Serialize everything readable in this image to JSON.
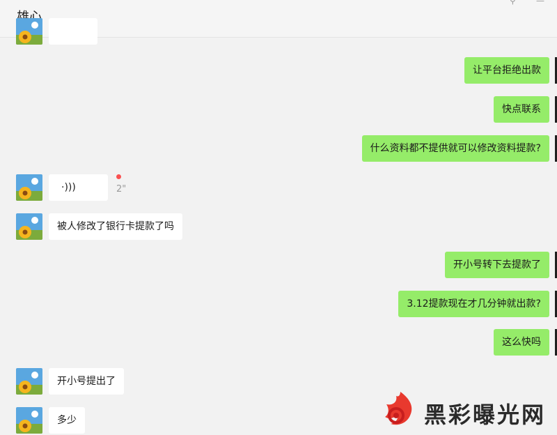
{
  "header": {
    "title": "雄心",
    "pin_icon": "pin-icon",
    "minimize_icon": "minimize-icon"
  },
  "colors": {
    "sent_bubble": "#95ec69",
    "received_bubble": "#ffffff",
    "unread_dot": "#fa5151"
  },
  "messages": [
    {
      "side": "left",
      "text": "",
      "partial": true
    },
    {
      "side": "right",
      "text": "让平台拒绝出款"
    },
    {
      "side": "right",
      "text": "快点联系"
    },
    {
      "side": "right",
      "text": "什么资料都不提供就可以修改资料提款?"
    },
    {
      "side": "left",
      "type": "voice",
      "voice_icon": "voice-wave-icon",
      "duration": "2\"",
      "unread": true
    },
    {
      "side": "left",
      "text": "被人修改了银行卡提款了吗"
    },
    {
      "side": "right",
      "text": "开小号转下去提款了"
    },
    {
      "side": "right",
      "text": "3.12提款现在才几分钟就出款?"
    },
    {
      "side": "right",
      "text": "这么快吗"
    },
    {
      "side": "left",
      "text": "开小号提出了"
    },
    {
      "side": "left",
      "text": "多少"
    }
  ],
  "watermark": {
    "text": "黑彩曝光网"
  }
}
